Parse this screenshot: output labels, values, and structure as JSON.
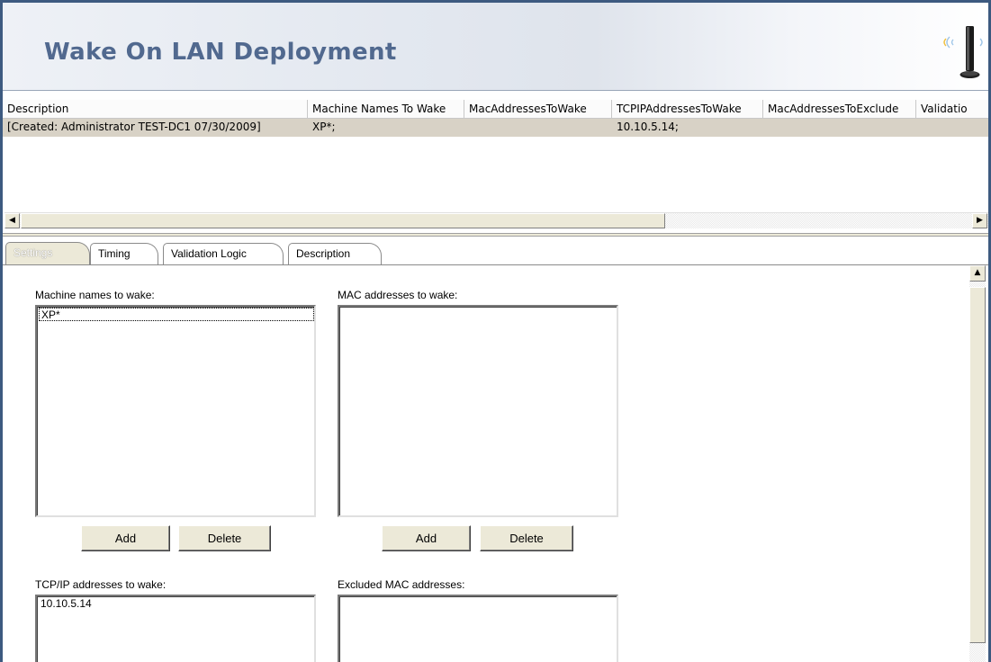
{
  "banner": {
    "title": "Wake On LAN Deployment",
    "icon": "wireless-device-icon"
  },
  "grid": {
    "columns": [
      "Description",
      "Machine Names To Wake",
      "MacAddressesToWake",
      "TCPIPAddressesToWake",
      "MacAddressesToExclude",
      "Validatio"
    ],
    "rows": [
      [
        "[Created: Administrator TEST-DC1 07/30/2009]",
        "XP*;",
        "",
        "10.10.5.14;",
        "",
        ""
      ]
    ],
    "selected_row_color": "#d8d2c6"
  },
  "tabs": [
    {
      "label": "Settings",
      "active": true
    },
    {
      "label": "Timing",
      "active": false
    },
    {
      "label": "Validation Logic",
      "active": false
    },
    {
      "label": "Description",
      "active": false
    }
  ],
  "settings": {
    "machine_names_label": "Machine names to wake:",
    "machine_names_items": [
      "XP*"
    ],
    "mac_addresses_label": "MAC addresses to wake:",
    "mac_addresses_items": [],
    "add_label": "Add",
    "delete_label": "Delete",
    "tcpip_label": "TCP/IP addresses to wake:",
    "tcpip_items": [
      "10.10.5.14"
    ],
    "excluded_mac_label": "Excluded MAC addresses:",
    "excluded_mac_items": []
  },
  "colors": {
    "frame_border": "#3d5a80",
    "title_color": "#51698f",
    "button_face": "#ece9d8"
  }
}
